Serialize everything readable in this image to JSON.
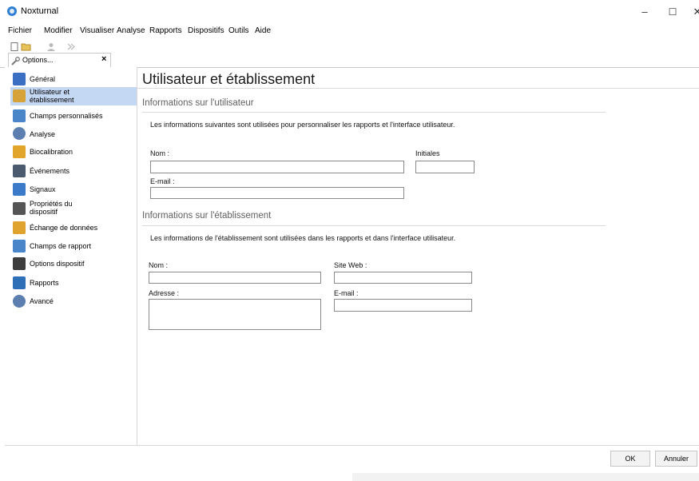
{
  "window": {
    "title": "Noxturnal",
    "controls": {
      "minimize": "–",
      "maximize": "☐",
      "close": "✕"
    }
  },
  "menu": {
    "items": [
      "Fichier",
      "Modifier",
      "Visualiser",
      "Analyse",
      "Rapports",
      "Dispositifs",
      "Outils",
      "Aide"
    ]
  },
  "toolbar": {
    "icons": [
      "new-document-icon",
      "open-folder-icon",
      "user-icon",
      "forward-icon"
    ]
  },
  "tab": {
    "label": "Options...",
    "close": "×",
    "icon": "tools-icon"
  },
  "sidebar": {
    "items": [
      {
        "label": "Général",
        "icon": "general-settings-icon",
        "color": "#3a6fc4"
      },
      {
        "label": "Utilisateur et établissement",
        "icon": "user-card-icon",
        "color": "#d6a23a"
      },
      {
        "label": "Champs personnalisés",
        "icon": "custom-fields-icon",
        "color": "#4a84c9"
      },
      {
        "label": "Analyse",
        "icon": "analysis-gears-icon",
        "color": "#5d7fb0"
      },
      {
        "label": "Biocalibration",
        "icon": "biocalibration-icon",
        "color": "#e2a52b"
      },
      {
        "label": "Événements",
        "icon": "events-icon",
        "color": "#4b5a6e"
      },
      {
        "label": "Signaux",
        "icon": "signals-icon",
        "color": "#3a7ac8"
      },
      {
        "label": "Propriétés du dispositif",
        "icon": "device-properties-icon",
        "color": "#555555"
      },
      {
        "label": "Échange de données",
        "icon": "data-exchange-icon",
        "color": "#e0a32f"
      },
      {
        "label": "Champs de rapport",
        "icon": "report-fields-icon",
        "color": "#4a84c9"
      },
      {
        "label": "Options dispositif",
        "icon": "device-options-icon",
        "color": "#3d3d3d"
      },
      {
        "label": "Rapports",
        "icon": "reports-icon",
        "color": "#2f6fb8"
      },
      {
        "label": "Avancé",
        "icon": "advanced-gears-icon",
        "color": "#5d7fb0"
      }
    ],
    "selected_index": 1,
    "selected_color": "#c4d7f3"
  },
  "main": {
    "title": "Utilisateur et établissement",
    "user_section": {
      "title": "Informations sur l'utilisateur",
      "description": "Les informations suivantes sont utilisées pour personnaliser les rapports et l'interface utilisateur.",
      "name_label": "Nom :",
      "name_value": "",
      "initials_label": "Initiales",
      "initials_value": "",
      "email_label": "E-mail :",
      "email_value": ""
    },
    "institution_section": {
      "title": "Informations sur l'établissement",
      "description": "Les informations de l'établissement sont utilisées dans les rapports et dans l'interface utilisateur.",
      "name_label": "Nom :",
      "name_value": "",
      "website_label": "Site Web :",
      "website_value": "",
      "address_label": "Adresse :",
      "address_value": "",
      "email_label": "E-mail :",
      "email_value": ""
    }
  },
  "footer": {
    "ok_label": "OK",
    "cancel_label": "Annuler"
  }
}
